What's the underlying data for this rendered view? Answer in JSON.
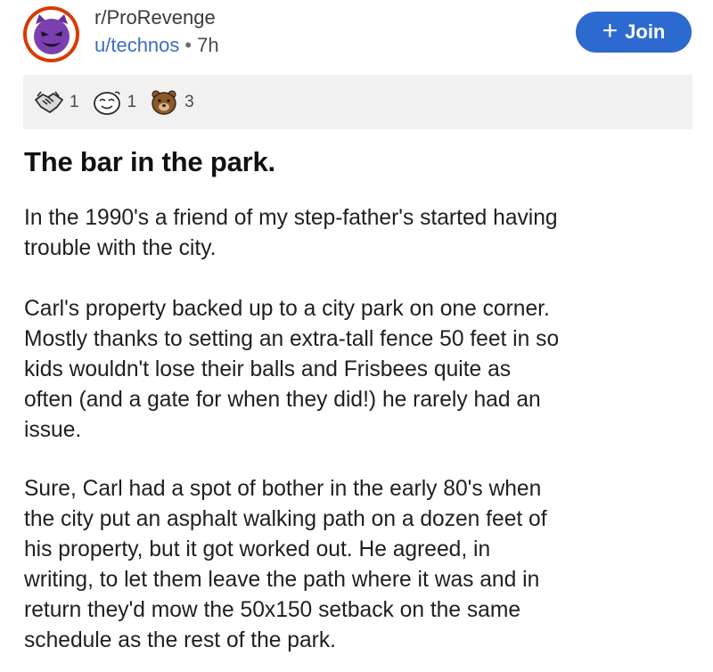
{
  "post": {
    "subreddit": "r/ProRevenge",
    "author": "u/technos",
    "separator": "•",
    "age": "7h",
    "join_plus": "+",
    "join_label": "Join",
    "awards": [
      {
        "icon": "handshake-award-icon",
        "count": "1"
      },
      {
        "icon": "wholesome-face-award-icon",
        "count": "1"
      },
      {
        "icon": "bear-award-icon",
        "count": "3"
      }
    ],
    "title": "The bar in the park.",
    "paragraphs": [
      "In the 1990's a friend of my step-father's started having\ntrouble with the city.",
      "Carl's property backed up to a city park on one corner.\nMostly thanks to setting an extra-tall fence 50 feet in so\nkids wouldn't lose their balls and Frisbees quite as\noften (and a gate for when they did!) he rarely had an\nissue.",
      "Sure, Carl had a spot of bother in the early 80's when\nthe city put an asphalt walking path on a dozen feet of\nhis property, but it got worked out. He agreed, in\nwriting, to let them leave the path where it was and in\nreturn they'd mow the 50x150 setback on the same\nschedule as the rest of the park."
    ]
  },
  "colors": {
    "join_button": "#2d6ad0",
    "avatar_ring": "#d93a00",
    "avatar_face": "#7b3fb0",
    "awards_bar": "#f1f1f1",
    "username": "#3d6dbf"
  }
}
